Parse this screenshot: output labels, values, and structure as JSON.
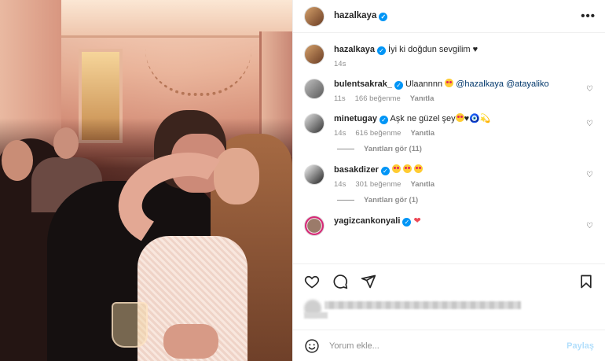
{
  "header": {
    "username": "hazalkaya",
    "verified": true,
    "more_label": "•••"
  },
  "caption": {
    "username": "hazalkaya",
    "text": "İyi ki doğdun sevgilim ♥",
    "time": "14s"
  },
  "comments": [
    {
      "username": "bulentsakrak_",
      "text_before": "Ulaannnn",
      "mentions": "@hazalkaya @atayaliko",
      "time": "11s",
      "likes": "166 beğenme",
      "reply": "Yanıtla"
    },
    {
      "username": "minetugay",
      "text_before": "Aşk ne güzel şey",
      "emoji_tail": "♥🧿💫",
      "time": "14s",
      "likes": "616 beğenme",
      "reply": "Yanıtla",
      "view_replies": "Yanıtları gör (11)"
    },
    {
      "username": "basakdizer",
      "time": "14s",
      "likes": "301 beğenme",
      "reply": "Yanıtla",
      "view_replies": "Yanıtları gör (1)"
    },
    {
      "username": "yagizcankonyali",
      "emoji": "❤"
    }
  ],
  "composer": {
    "placeholder": "Yorum ekle...",
    "post_label": "Paylaş"
  },
  "colors": {
    "link": "#00376b",
    "verified": "#0095f6",
    "muted": "#8e8e8e",
    "post_disabled": "#b2dffc"
  }
}
